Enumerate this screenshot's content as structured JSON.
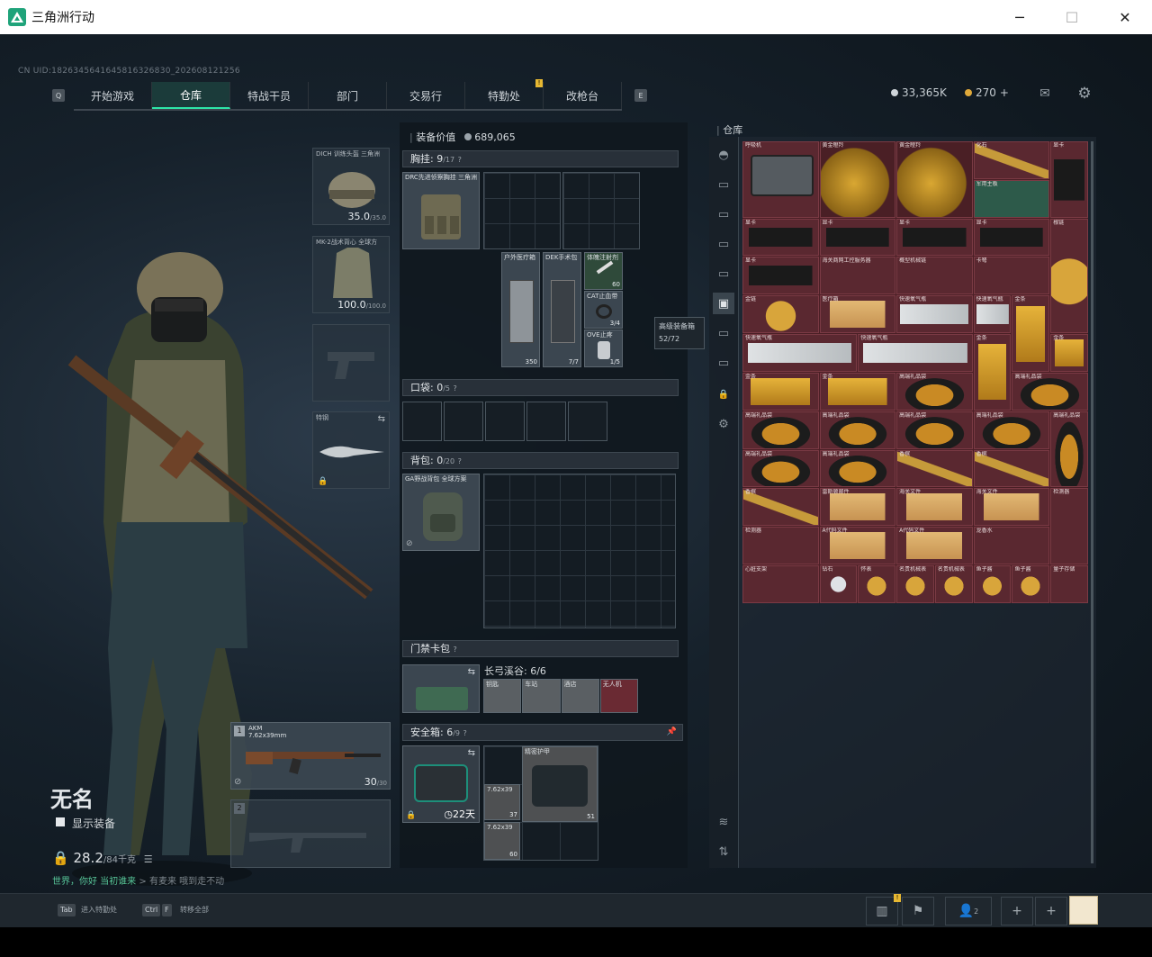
{
  "window": {
    "title": "三角洲行动",
    "minimize": "─",
    "maximize": "☐",
    "close": "✕"
  },
  "uid": "CN UID:1826345641645816326830_202608121256",
  "nav": {
    "tabs": [
      "开始游戏",
      "仓库",
      "特战干员",
      "部门",
      "交易行",
      "特勤处",
      "改枪台"
    ],
    "active": "仓库",
    "left_key": "Q",
    "right_key": "E",
    "badge": "!"
  },
  "currency": {
    "coins": "33,365K",
    "tickets": "270",
    "plus": "+"
  },
  "operator": {
    "name": "无名",
    "show_gear": "显示装备",
    "weight": "28.2",
    "weight_max": "/84千克",
    "quote_link": "世界，你好 当初谁来",
    "quote_sep": ">",
    "quote_text": "有麦来 哦到走不动"
  },
  "gear": {
    "helmet": {
      "label": "DICH 训练头盔 三角洲",
      "value": "35.0",
      "max": "/35.0"
    },
    "armor": {
      "label": "MK-2战术背心 全球方",
      "value": "100.0",
      "max": "/100.0"
    },
    "melee": {
      "label": "特钢"
    },
    "weapon1": {
      "slot": "1",
      "label": "AKM",
      "sub": "7.62x39mm",
      "ammo": "30",
      "ammo_max": "/30"
    },
    "weapon2": {
      "slot": "2"
    }
  },
  "middle": {
    "equip_value_label": "装备价值",
    "equip_value": "689,065",
    "chest": {
      "title": "胸挂:",
      "count": "9",
      "max": "/17",
      "help": "?",
      "rig_label": "DRC先进侦察胸挂 三角洲",
      "items": [
        {
          "label": "户外医疗箱",
          "value": "350"
        },
        {
          "label": "DEK手术包",
          "value": "7/7"
        },
        {
          "label": "体魄注射剂",
          "value": "60"
        },
        {
          "label": "CAT止血带",
          "value": "3/4"
        },
        {
          "label": "OVE止疼",
          "value": "1/5"
        }
      ]
    },
    "pocket": {
      "title": "口袋:",
      "count": "0",
      "max": "/5",
      "help": "?"
    },
    "backpack": {
      "title": "背包:",
      "count": "0",
      "max": "/20",
      "help": "?",
      "bag_label": "GA野战背包 全球方案"
    },
    "keycard": {
      "title": "门禁卡包",
      "help": "?",
      "zone": "长弓溪谷: 6/6",
      "cards": [
        "钥匙",
        "车站",
        "酒店",
        "无人机"
      ]
    },
    "safebox": {
      "title": "安全箱:",
      "count": "6",
      "max": "/9",
      "help": "?",
      "timer": "22天",
      "items": [
        {
          "label": "7.62x39",
          "value": "37"
        },
        {
          "label": "精密护甲",
          "value": "51"
        },
        {
          "label": "7.62x39",
          "value": "60"
        }
      ]
    },
    "tooltip": {
      "title": "高级装备箱",
      "value": "52/72"
    }
  },
  "stash": {
    "title": "仓库",
    "items": [
      "呼吸机",
      "黄金瞪羚",
      "黄金瞪羚",
      "化石",
      "显卡",
      "显卡",
      "显卡",
      "显卡",
      "显卡",
      "军用主板",
      "显卡",
      "海关商网工控服务器",
      "概型机械链",
      "卡弩",
      "根链",
      "金链",
      "医疗箱",
      "快速氧气瓶",
      "快速氧气瓶",
      "金条",
      "金条",
      "快速氧气瓶",
      "快速氧气瓶",
      "金条",
      "金条",
      "金条",
      "高端礼品袋",
      "高端礼品袋",
      "高端礼品袋",
      "高端礼品袋",
      "高端礼品袋",
      "高端礼品袋",
      "高端礼品袋",
      "高端礼品袋",
      "高端礼品袋",
      "高端礼品袋",
      "香槟",
      "香槟",
      "香槟",
      "香槟",
      "雷斯顿邮件",
      "海关文件",
      "海关文件",
      "检测器",
      "检测器",
      "A代码文件",
      "A代码文件",
      "龙香水",
      "心脏支架",
      "钻石",
      "怀表",
      "名贵机械表",
      "名贵机械表",
      "鱼子酱",
      "鱼子酱",
      "量子存储"
    ]
  },
  "bottom": {
    "keys": [
      {
        "key": "Tab",
        "label": "进入特勤处"
      },
      {
        "key": "Ctrl",
        "key2": "F",
        "label": "转移全部"
      }
    ],
    "team_count": "2",
    "notif": "!"
  },
  "colors": {
    "accent": "#2ee6a8",
    "stash_red": "#5a2830",
    "gold": "#d9a732"
  }
}
